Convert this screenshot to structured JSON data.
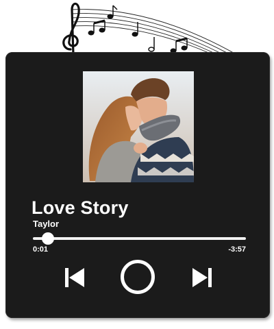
{
  "player": {
    "song_title": "Love Story",
    "artist": "Taylor",
    "progress_fraction": 0.07,
    "time_elapsed": "0:01",
    "time_remaining": "-3:57"
  },
  "icons": {
    "decoration": "music-notes-icon",
    "previous": "skip-previous-icon",
    "play": "play-circle-icon",
    "next": "skip-next-icon"
  },
  "colors": {
    "plaque": "#1b1b1b",
    "text": "#ffffff",
    "progress_track": "#f2f2f2"
  }
}
